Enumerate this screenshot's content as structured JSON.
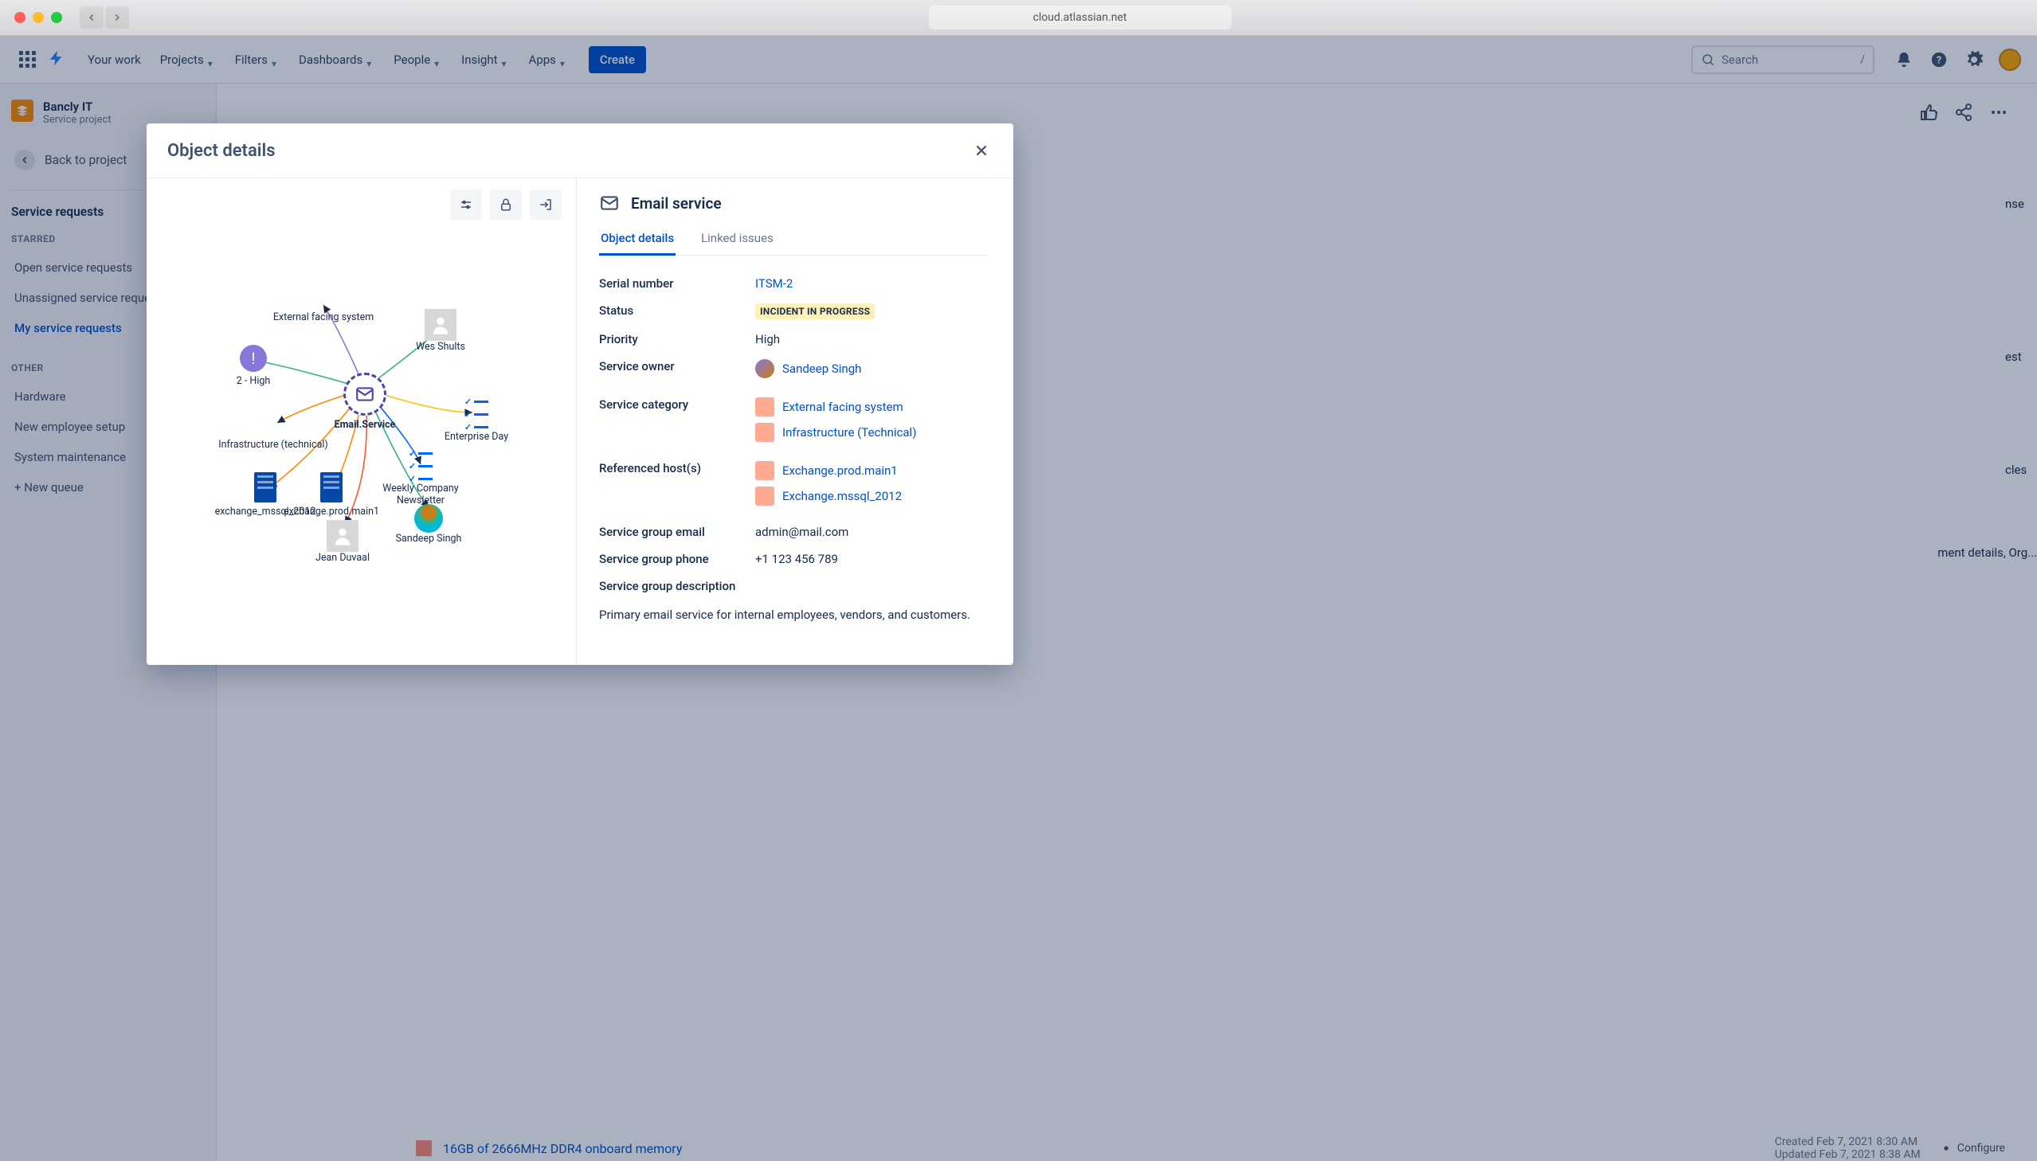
{
  "browser": {
    "url": "cloud.atlassian.net"
  },
  "topnav": {
    "items": [
      "Your work",
      "Projects",
      "Filters",
      "Dashboards",
      "People",
      "Insight",
      "Apps"
    ],
    "create": "Create",
    "search_placeholder": "Search",
    "search_key": "/"
  },
  "sidebar": {
    "project_name": "Bancly IT",
    "project_type": "Service project",
    "back": "Back to project",
    "heading": "Service requests",
    "starred_label": "STARRED",
    "starred": [
      "Open service requests",
      "Unassigned service requests",
      "My service requests"
    ],
    "other_label": "OTHER",
    "other": [
      "Hardware",
      "New employee setup",
      "System maintenance",
      "+ New queue"
    ]
  },
  "modal": {
    "title": "Object details",
    "object_title": "Email service",
    "tabs": [
      "Object details",
      "Linked issues"
    ],
    "graph": {
      "center": "Email.Service",
      "nodes": {
        "ext_facing": "External facing system",
        "priority": "2 - High",
        "infra": "Infrastructure (technical)",
        "exch_mssql": "exchange_mssql_2012",
        "exch_prod": "exchange.prod.main1",
        "jean": "Jean Duvaal",
        "sandeep": "Sandeep Singh",
        "newsletter": "Weekly Company Newsletter",
        "ent_day": "Enterprise Day",
        "wes": "Wes Shults"
      }
    },
    "details": {
      "serial_label": "Serial number",
      "serial_value": "ITSM-2",
      "status_label": "Status",
      "status_value": "INCIDENT IN PROGRESS",
      "priority_label": "Priority",
      "priority_value": "High",
      "owner_label": "Service owner",
      "owner_value": "Sandeep Singh",
      "category_label": "Service category",
      "category_values": [
        "External facing system",
        "Infrastructure (Technical)"
      ],
      "hosts_label": "Referenced host(s)",
      "hosts_values": [
        "Exchange.prod.main1",
        "Exchange.mssql_2012"
      ],
      "email_label": "Service group email",
      "email_value": "admin@mail.com",
      "phone_label": "Service group phone",
      "phone_value": "+1 123 456 789",
      "desc_label": "Service group description",
      "desc_value": "Primary email service for internal employees, vendors, and customers."
    }
  },
  "bleed": {
    "created": "Created Feb 7, 2021 8:30 AM",
    "updated": "Updated Feb 7, 2021 8:38 AM",
    "configure": "Configure",
    "memory": "16GB of 2666MHz DDR4 onboard memory",
    "text1": "nse",
    "text2": "est",
    "text3": "cles",
    "text4": "ment details, Org..."
  }
}
